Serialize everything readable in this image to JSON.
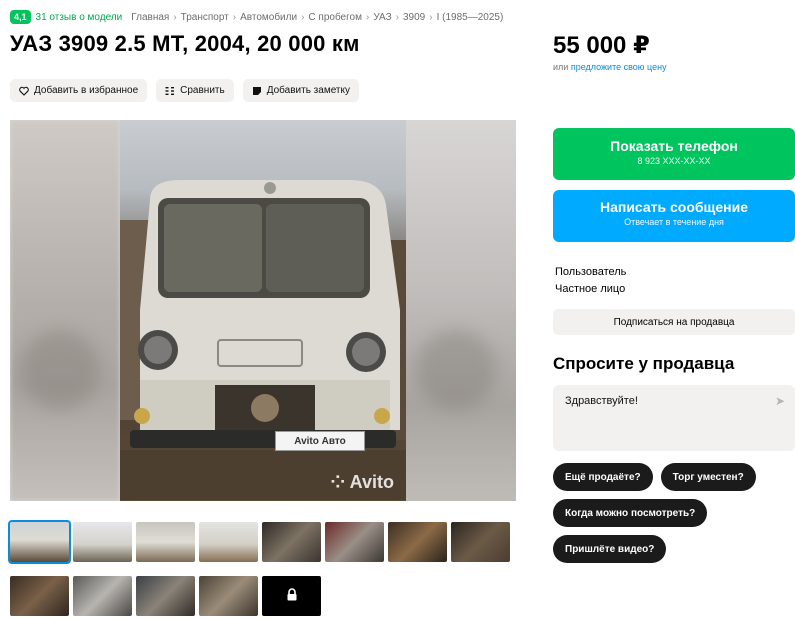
{
  "meta": {
    "rating": "4,1",
    "reviews": "31 отзыв о модели",
    "breadcrumbs": [
      "Главная",
      "Транспорт",
      "Автомобили",
      "С пробегом",
      "УАЗ",
      "3909",
      "I (1985—2025)"
    ]
  },
  "listing": {
    "title": "УАЗ 3909 2.5 МТ, 2004, 20 000 км",
    "price": "55 000 ₽",
    "offer_prefix": "или",
    "offer_link": "предложите свою цену"
  },
  "actions": {
    "favorite": "Добавить в избранное",
    "compare": "Сравнить",
    "note": "Добавить заметку"
  },
  "photo": {
    "plate_text": "Avito Авто",
    "watermark": "Avito"
  },
  "contact": {
    "phone_label": "Показать телефон",
    "phone_number": "8 923 XXX-XX-XX",
    "message_label": "Написать сообщение",
    "message_sub": "Отвечает в течение дня"
  },
  "seller": {
    "name": "Пользователь",
    "type": "Частное лицо",
    "subscribe": "Подписаться на продавца"
  },
  "ask": {
    "title": "Спросите у продавца",
    "input_value": "Здравствуйте!",
    "chips": [
      "Ещё продаёте?",
      "Торг уместен?",
      "Когда можно посмотреть?",
      "Пришлёте видео?"
    ]
  },
  "colors": {
    "green": "#00c55e",
    "blue": "#00aaff",
    "link": "#0a8cd8"
  }
}
